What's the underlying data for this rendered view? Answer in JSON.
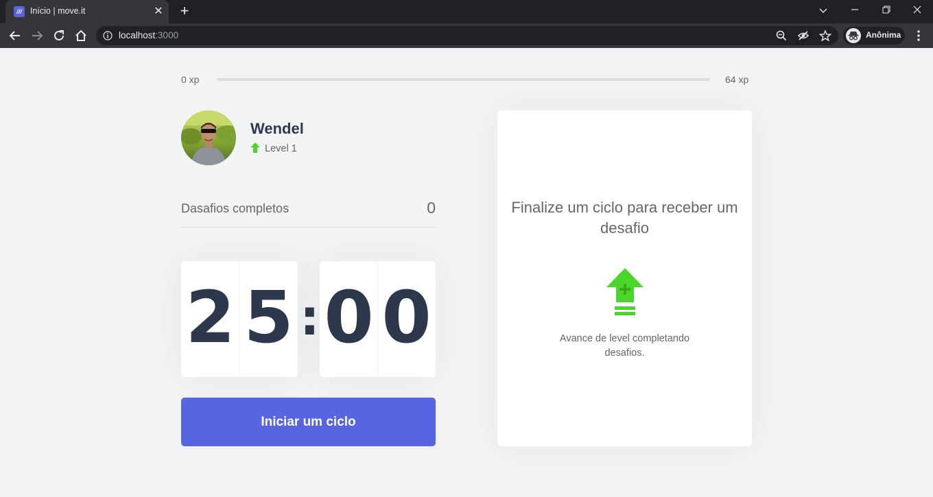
{
  "browser": {
    "tab_title": "Início | move.it",
    "tab_favicon": "///",
    "address_host": "localhost",
    "address_port": ":3000",
    "profile_label": "Anônima"
  },
  "experience": {
    "min_label": "0 xp",
    "max_label": "64 xp",
    "progress": 0
  },
  "profile": {
    "name": "Wendel",
    "level_label": "Level 1"
  },
  "challenges_completed": {
    "label": "Dasafios completos",
    "value": "0"
  },
  "countdown": {
    "minute_left": "2",
    "minute_right": "5",
    "separator": ":",
    "second_left": "0",
    "second_right": "0"
  },
  "start_button_label": "Iniciar um ciclo",
  "challenge_box": {
    "title": "Finalize um ciclo para receber um desafio",
    "hint": "Avance de level completando desafios."
  },
  "colors": {
    "accent": "#5965e0",
    "level_green": "#4cd62b",
    "text": "#666666",
    "title": "#2e384d"
  }
}
